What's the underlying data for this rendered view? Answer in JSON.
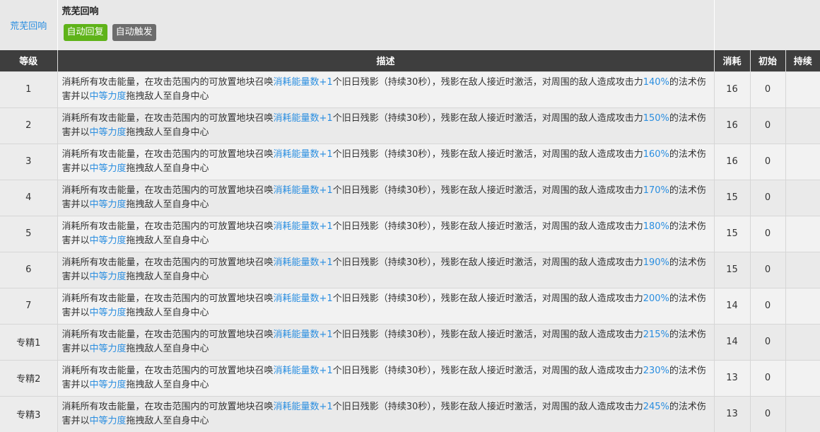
{
  "skill": {
    "link_label": "荒芜回响",
    "title": "荒芜回响",
    "badges": [
      "自动回复",
      "自动触发"
    ]
  },
  "columns": [
    "等级",
    "描述",
    "消耗",
    "初始",
    "持续"
  ],
  "desc": {
    "part1": "消耗所有攻击能量，在攻击范围内的可放置地块召唤",
    "highlight1": "消耗能量数+1",
    "part2": "个旧日残影（持续30秒），残影在敌人接近时激活，对周围的敌人造成攻击力",
    "part3": "的法术伤害并以",
    "highlight2": "中等力度",
    "part4": "拖拽敌人至自身中心"
  },
  "rows": [
    {
      "level": "1",
      "percent": "140%",
      "cost": "16",
      "init": "0",
      "duration": ""
    },
    {
      "level": "2",
      "percent": "150%",
      "cost": "16",
      "init": "0",
      "duration": ""
    },
    {
      "level": "3",
      "percent": "160%",
      "cost": "16",
      "init": "0",
      "duration": ""
    },
    {
      "level": "4",
      "percent": "170%",
      "cost": "15",
      "init": "0",
      "duration": ""
    },
    {
      "level": "5",
      "percent": "180%",
      "cost": "15",
      "init": "0",
      "duration": ""
    },
    {
      "level": "6",
      "percent": "190%",
      "cost": "15",
      "init": "0",
      "duration": ""
    },
    {
      "level": "7",
      "percent": "200%",
      "cost": "14",
      "init": "0",
      "duration": ""
    },
    {
      "level": "专精1",
      "percent": "215%",
      "cost": "14",
      "init": "0",
      "duration": ""
    },
    {
      "level": "专精2",
      "percent": "230%",
      "cost": "13",
      "init": "0",
      "duration": ""
    },
    {
      "level": "专精3",
      "percent": "245%",
      "cost": "13",
      "init": "0",
      "duration": ""
    }
  ],
  "colors": {
    "link": "#2a8ee0",
    "badge_auto_recover": "#5fb319",
    "badge_auto_trigger": "#6c6c6c",
    "header_bg": "#3e3e3e"
  }
}
